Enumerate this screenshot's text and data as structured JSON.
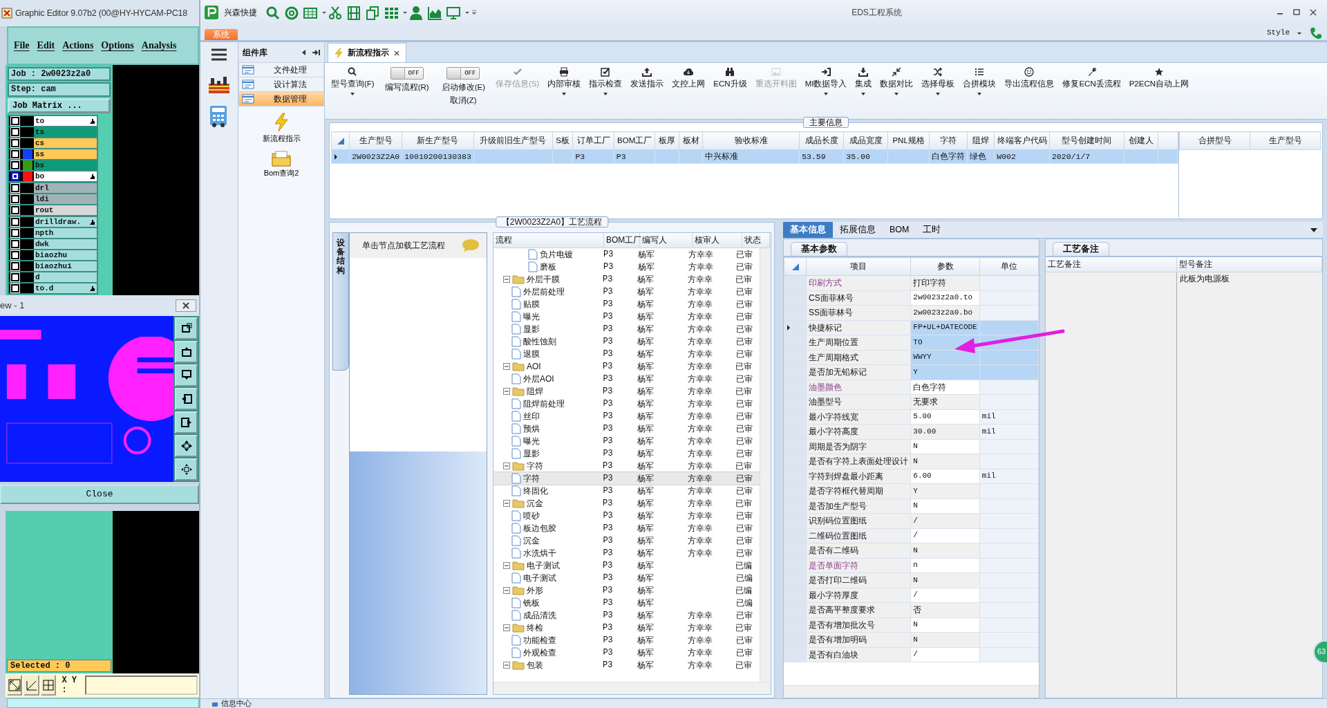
{
  "editor": {
    "title": "Graphic Editor 9.07b2 (00@HY-HYCAM-PC18",
    "menu": [
      "File",
      "Edit",
      "Actions",
      "Options",
      "Analysis"
    ],
    "job": "Job : 2w0023z2a0",
    "step": "Step: cam",
    "matrix_button": "Job Matrix ...",
    "layer_groups": [
      [
        {
          "name": "to",
          "color": "#ffffff",
          "selected": false,
          "marked": true
        },
        {
          "name": "ts",
          "color": "#0e9a78",
          "selected": false,
          "marked": false
        },
        {
          "name": "cs",
          "color": "#ffc857",
          "selected": false,
          "marked": false
        },
        {
          "name": "ss",
          "color": "#ffc857",
          "swatch": {
            "color": "#1040ff"
          },
          "selected": false,
          "marked": false
        },
        {
          "name": "bs",
          "color": "#0e9a78",
          "swatch": {
            "color": "#3a9a10"
          },
          "selected": false,
          "marked": false
        },
        {
          "name": "bo",
          "color": "#ffffff",
          "swatch": {
            "color": "#ff1010"
          },
          "selected": true,
          "marked": true
        }
      ],
      [
        {
          "name": "drl",
          "color": "#9fb3b8",
          "selected": false,
          "marked": false
        },
        {
          "name": "ldi",
          "color": "#9fb3b8",
          "selected": false,
          "marked": false
        },
        {
          "name": "rout",
          "color": "#d8d8d8",
          "selected": false,
          "marked": false
        }
      ],
      [
        {
          "name": "drilldraw.",
          "color": "#a6dede",
          "selected": false,
          "marked": true
        },
        {
          "name": "npth",
          "color": "#a6dede",
          "selected": false,
          "marked": false
        },
        {
          "name": "dwk",
          "color": "#a6dede",
          "selected": false,
          "marked": false
        },
        {
          "name": "biaozhu",
          "color": "#a6dede",
          "selected": false,
          "marked": false
        },
        {
          "name": "biaozhu1",
          "color": "#a6dede",
          "selected": false,
          "marked": false
        },
        {
          "name": "d",
          "color": "#a6dede",
          "selected": false,
          "marked": false
        },
        {
          "name": "to.d",
          "color": "#a6dede",
          "selected": false,
          "marked": true
        }
      ]
    ],
    "preview": {
      "title": "ew - 1",
      "close_button": "Close"
    },
    "selected_count": "Selected : 0",
    "xy_label": "X Y :"
  },
  "app": {
    "brand": "兴森快捷",
    "title": "EDS工程系统",
    "system_tab": "系统",
    "style_menu": "Style",
    "components": {
      "title": "组件库",
      "items": [
        {
          "label": "文件处理",
          "selected": false
        },
        {
          "label": "设计算法",
          "selected": false
        },
        {
          "label": "数据管理",
          "selected": true
        }
      ],
      "tools": [
        {
          "label": "新流程指示",
          "kind": "lightning"
        },
        {
          "label": "Bom查询2",
          "kind": "folder"
        }
      ]
    },
    "doc_tabs": [
      {
        "label": "新流程指示",
        "selected": true
      }
    ],
    "ribbon": [
      {
        "kind": "button",
        "label": "型号查询(F)",
        "dropdown": true,
        "disabled": false
      },
      {
        "kind": "toggle",
        "label": "编写流程(R)",
        "state_text": "OFF",
        "on": false
      },
      {
        "kind": "toggle",
        "label": "启动修改(E)",
        "sublabel": "取消(Z)",
        "state_text": "OFF",
        "on": false
      },
      {
        "kind": "button",
        "label": "保存信息(S)",
        "dropdown": false,
        "disabled": true
      },
      {
        "kind": "button",
        "label": "内部审核",
        "dropdown": true,
        "disabled": false
      },
      {
        "kind": "button",
        "label": "指示检查",
        "dropdown": true,
        "disabled": false
      },
      {
        "kind": "button",
        "label": "发送指示",
        "dropdown": false,
        "disabled": false
      },
      {
        "kind": "button",
        "label": "文控上网",
        "dropdown": false,
        "disabled": false
      },
      {
        "kind": "button",
        "label": "ECN升级",
        "dropdown": false,
        "disabled": false
      },
      {
        "kind": "button",
        "label": "重选开料图",
        "dropdown": false,
        "disabled": true
      },
      {
        "kind": "button",
        "label": "MI数据导入",
        "dropdown": true,
        "disabled": false
      },
      {
        "kind": "button",
        "label": "集成",
        "dropdown": true,
        "disabled": false
      },
      {
        "kind": "button",
        "label": "数据对比",
        "dropdown": true,
        "disabled": false
      },
      {
        "kind": "button",
        "label": "选择母板",
        "dropdown": true,
        "disabled": false
      },
      {
        "kind": "button",
        "label": "合拼模块",
        "dropdown": true,
        "disabled": false
      },
      {
        "kind": "button",
        "label": "导出流程信息",
        "dropdown": false,
        "disabled": false
      },
      {
        "kind": "button",
        "label": "修复ECN丢流程",
        "dropdown": false,
        "disabled": false
      },
      {
        "kind": "button",
        "label": "P2ECN自动上网",
        "dropdown": false,
        "disabled": false
      }
    ],
    "main_info": {
      "title": "主要信息",
      "row_selected": true,
      "columns": [
        {
          "label": "生产型号",
          "value": "2W0023Z2A0"
        },
        {
          "label": "新生产型号",
          "value": "10010200130383"
        },
        {
          "label": "升级前旧生产型号"
        },
        {
          "label": "S板"
        },
        {
          "label": "订单工厂",
          "value": "P3"
        },
        {
          "label": "BOM工厂",
          "value": "P3"
        },
        {
          "label": "板厚"
        },
        {
          "label": "板材"
        },
        {
          "label": "验收标准",
          "value": "中兴标准"
        },
        {
          "label": "成品长度",
          "value": "53.59"
        },
        {
          "label": "成品宽度",
          "value": "35.00"
        },
        {
          "label": "PNL规格"
        },
        {
          "label": "字符",
          "value": "白色字符"
        },
        {
          "label": "阻焊",
          "value": "绿色"
        },
        {
          "label": "终端客户代码",
          "value": "W002"
        },
        {
          "label": "型号创建时间",
          "value": "2020/1/7"
        },
        {
          "label": "创建人"
        }
      ],
      "side_columns": [
        "合拼型号",
        "生产型号"
      ]
    },
    "process": {
      "title": "【2W0023Z2A0】工艺流程",
      "side_tab": "设备结构",
      "hint": "单击节点加载工艺流程",
      "columns": [
        "流程",
        "BOM工厂",
        "编写人",
        "核审人",
        "状态"
      ],
      "tree": [
        {
          "kind": "offscreen",
          "children": [
            {
              "kind": "file",
              "label": "负片电镀",
              "bom": "P3",
              "writer": "杨军",
              "reviewer": "方幸幸",
              "status": "已审",
              "selected": false
            },
            {
              "kind": "file",
              "label": "磨板",
              "bom": "P3",
              "writer": "杨军",
              "reviewer": "方幸幸",
              "status": "已审",
              "selected": false
            }
          ]
        },
        {
          "kind": "folder",
          "label": "外层干膜",
          "bom": "P3",
          "writer": "杨军",
          "reviewer": "方幸幸",
          "status": "已审",
          "selected": false,
          "expanded": true,
          "children": [
            {
              "kind": "file",
              "label": "外层前处理",
              "bom": "P3",
              "writer": "杨军",
              "reviewer": "方幸幸",
              "status": "已审",
              "selected": false
            },
            {
              "kind": "file",
              "label": "贴膜",
              "bom": "P3",
              "writer": "杨军",
              "reviewer": "方幸幸",
              "status": "已审",
              "selected": false
            },
            {
              "kind": "file",
              "label": "曝光",
              "bom": "P3",
              "writer": "杨军",
              "reviewer": "方幸幸",
              "status": "已审",
              "selected": false
            },
            {
              "kind": "file",
              "label": "显影",
              "bom": "P3",
              "writer": "杨军",
              "reviewer": "方幸幸",
              "status": "已审",
              "selected": false
            },
            {
              "kind": "file",
              "label": "酸性蚀刻",
              "bom": "P3",
              "writer": "杨军",
              "reviewer": "方幸幸",
              "status": "已审",
              "selected": false
            },
            {
              "kind": "file",
              "label": "退膜",
              "bom": "P3",
              "writer": "杨军",
              "reviewer": "方幸幸",
              "status": "已审",
              "selected": false
            }
          ]
        },
        {
          "kind": "folder",
          "label": "AOI",
          "bom": "P3",
          "writer": "杨军",
          "reviewer": "方幸幸",
          "status": "已审",
          "selected": false,
          "expanded": true,
          "children": [
            {
              "kind": "file",
              "label": "外层AOI",
              "bom": "P3",
              "writer": "杨军",
              "reviewer": "方幸幸",
              "status": "已审",
              "selected": false
            }
          ]
        },
        {
          "kind": "folder",
          "label": "阻焊",
          "bom": "P3",
          "writer": "杨军",
          "reviewer": "方幸幸",
          "status": "已审",
          "selected": false,
          "expanded": true,
          "children": [
            {
              "kind": "file",
              "label": "阻焊前处理",
              "bom": "P3",
              "writer": "杨军",
              "reviewer": "方幸幸",
              "status": "已审",
              "selected": false
            },
            {
              "kind": "file",
              "label": "丝印",
              "bom": "P3",
              "writer": "杨军",
              "reviewer": "方幸幸",
              "status": "已审",
              "selected": false
            },
            {
              "kind": "file",
              "label": "预烘",
              "bom": "P3",
              "writer": "杨军",
              "reviewer": "方幸幸",
              "status": "已审",
              "selected": false
            },
            {
              "kind": "file",
              "label": "曝光",
              "bom": "P3",
              "writer": "杨军",
              "reviewer": "方幸幸",
              "status": "已审",
              "selected": false
            },
            {
              "kind": "file",
              "label": "显影",
              "bom": "P3",
              "writer": "杨军",
              "reviewer": "方幸幸",
              "status": "已审",
              "selected": false
            }
          ]
        },
        {
          "kind": "folder",
          "label": "字符",
          "bom": "P3",
          "writer": "杨军",
          "reviewer": "方幸幸",
          "status": "已审",
          "selected": false,
          "expanded": true,
          "children": [
            {
              "kind": "file",
              "label": "字符",
              "bom": "P3",
              "writer": "杨军",
              "reviewer": "方幸幸",
              "status": "已审",
              "selected": true
            },
            {
              "kind": "file",
              "label": "终固化",
              "bom": "P3",
              "writer": "杨军",
              "reviewer": "方幸幸",
              "status": "已审",
              "selected": false
            }
          ]
        },
        {
          "kind": "folder",
          "label": "沉金",
          "bom": "P3",
          "writer": "杨军",
          "reviewer": "方幸幸",
          "status": "已审",
          "selected": false,
          "expanded": true,
          "children": [
            {
              "kind": "file",
              "label": "喷砂",
              "bom": "P3",
              "writer": "杨军",
              "reviewer": "方幸幸",
              "status": "已审",
              "selected": false
            },
            {
              "kind": "file",
              "label": "板边包胶",
              "bom": "P3",
              "writer": "杨军",
              "reviewer": "方幸幸",
              "status": "已审",
              "selected": false
            },
            {
              "kind": "file",
              "label": "沉金",
              "bom": "P3",
              "writer": "杨军",
              "reviewer": "方幸幸",
              "status": "已审",
              "selected": false
            },
            {
              "kind": "file",
              "label": "水洗烘干",
              "bom": "P3",
              "writer": "杨军",
              "reviewer": "方幸幸",
              "status": "已审",
              "selected": false
            }
          ]
        },
        {
          "kind": "folder",
          "label": "电子测试",
          "bom": "P3",
          "writer": "杨军",
          "status": "已编",
          "selected": false,
          "expanded": true,
          "children": [
            {
              "kind": "file",
              "label": "电子测试",
              "bom": "P3",
              "writer": "杨军",
              "status": "已编",
              "selected": false
            }
          ]
        },
        {
          "kind": "folder",
          "label": "外形",
          "bom": "P3",
          "writer": "杨军",
          "status": "已编",
          "selected": false,
          "expanded": true,
          "children": [
            {
              "kind": "file",
              "label": "铣板",
              "bom": "P3",
              "writer": "杨军",
              "status": "已编",
              "selected": false
            },
            {
              "kind": "file",
              "label": "成品清洗",
              "bom": "P3",
              "writer": "杨军",
              "reviewer": "方幸幸",
              "status": "已审",
              "selected": false
            }
          ]
        },
        {
          "kind": "folder",
          "label": "终检",
          "bom": "P3",
          "writer": "杨军",
          "reviewer": "方幸幸",
          "status": "已审",
          "selected": false,
          "expanded": true,
          "children": [
            {
              "kind": "file",
              "label": "功能检查",
              "bom": "P3",
              "writer": "杨军",
              "reviewer": "方幸幸",
              "status": "已审",
              "selected": false
            },
            {
              "kind": "file",
              "label": "外观检查",
              "bom": "P3",
              "writer": "杨军",
              "reviewer": "方幸幸",
              "status": "已审",
              "selected": false
            }
          ]
        },
        {
          "kind": "folder",
          "label": "包装",
          "bom": "P3",
          "writer": "杨军",
          "reviewer": "方幸幸",
          "status": "已审",
          "selected": false,
          "expanded": true
        }
      ]
    },
    "params": {
      "tabs": [
        {
          "label": "基本信息",
          "selected": true
        },
        {
          "label": "拓展信息",
          "selected": false
        },
        {
          "label": "BOM",
          "selected": false
        },
        {
          "label": "工时",
          "selected": false
        }
      ],
      "subtab": "基本参数",
      "columns": [
        "项目",
        "参数",
        "单位"
      ],
      "rows": [
        {
          "item": "印刷方式",
          "value": "打印字符",
          "emphasis": true,
          "selected": false,
          "current": false
        },
        {
          "item": "CS面菲林号",
          "value": "2w0023z2a0.to",
          "emphasis": false,
          "selected": false,
          "current": false
        },
        {
          "item": "SS面菲林号",
          "value": "2w0023z2a0.bo",
          "emphasis": false,
          "selected": false,
          "current": false
        },
        {
          "item": "快捷标记",
          "value": "FP+UL+DATECODE",
          "emphasis": false,
          "selected": true,
          "current": true
        },
        {
          "item": "生产周期位置",
          "value": "TO",
          "emphasis": false,
          "selected": true,
          "current": false
        },
        {
          "item": "生产周期格式",
          "value": "WWYY",
          "emphasis": false,
          "selected": true,
          "current": false
        },
        {
          "item": "是否加无铅标记",
          "value": "Y",
          "emphasis": false,
          "selected": true,
          "current": false
        },
        {
          "item": "油墨颜色",
          "value": "白色字符",
          "emphasis": true,
          "selected": false,
          "current": false
        },
        {
          "item": "油墨型号",
          "value": "无要求",
          "emphasis": false,
          "selected": false,
          "current": false
        },
        {
          "item": "最小字符线宽",
          "value": "5.00",
          "unit": "mil",
          "emphasis": false,
          "selected": false,
          "current": false
        },
        {
          "item": "最小字符高度",
          "value": "30.00",
          "unit": "mil",
          "emphasis": false,
          "selected": false,
          "current": false
        },
        {
          "item": "周期是否为阴字",
          "value": "N",
          "emphasis": false,
          "selected": false,
          "current": false
        },
        {
          "item": "是否有字符上表面处理设计",
          "value": "N",
          "emphasis": false,
          "selected": false,
          "current": false
        },
        {
          "item": "字符到焊盘最小距离",
          "value": "6.00",
          "unit": "mil",
          "emphasis": false,
          "selected": false,
          "current": false
        },
        {
          "item": "是否字符框代替周期",
          "value": "Y",
          "emphasis": false,
          "selected": false,
          "current": false
        },
        {
          "item": "是否加生产型号",
          "value": "N",
          "emphasis": false,
          "selected": false,
          "current": false
        },
        {
          "item": "识别码位置图纸",
          "value": "/",
          "emphasis": false,
          "selected": false,
          "current": false
        },
        {
          "item": "二维码位置图纸",
          "value": "/",
          "emphasis": false,
          "selected": false,
          "current": false
        },
        {
          "item": "是否有二维码",
          "value": "N",
          "emphasis": false,
          "selected": false,
          "current": false
        },
        {
          "item": "是否单面字符",
          "value": "n",
          "emphasis": true,
          "selected": false,
          "current": false
        },
        {
          "item": "是否打印二维码",
          "value": "N",
          "emphasis": false,
          "selected": false,
          "current": false
        },
        {
          "item": "最小字符厚度",
          "value": "/",
          "emphasis": false,
          "selected": false,
          "current": false
        },
        {
          "item": "是否高平整度要求",
          "value": "否",
          "emphasis": false,
          "selected": false,
          "current": false
        },
        {
          "item": "是否有增加批次号",
          "value": "N",
          "emphasis": false,
          "selected": false,
          "current": false
        },
        {
          "item": "是否有增加明码",
          "value": "N",
          "emphasis": false,
          "selected": false,
          "current": false
        },
        {
          "item": "是否有白油块",
          "value": "/",
          "emphasis": false,
          "selected": false,
          "current": false
        }
      ]
    },
    "notes": {
      "tab": "工艺备注",
      "columns": [
        "工艺备注",
        "型号备注"
      ],
      "model_note": "此板为电源板"
    },
    "status_bar": {
      "info": "信息中心"
    },
    "badge": "63"
  }
}
